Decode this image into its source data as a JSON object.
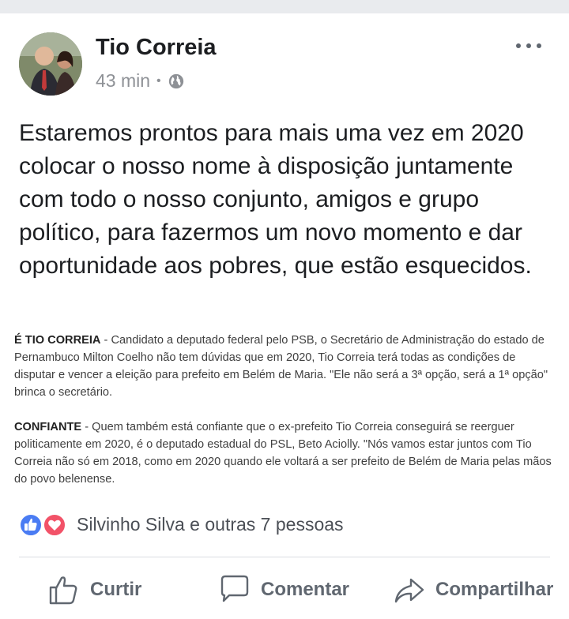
{
  "post": {
    "author": "Tio Correia",
    "time": "43 min",
    "separator": "•",
    "privacy_icon": "globe-icon",
    "menu_icon": "more-options-icon",
    "text": "Estaremos prontos para mais uma vez em 2020 colocar o nosso nome à disposição juntamente com todo o nosso conjunto, amigos e grupo político, para fazermos um novo momento e dar oportunidade aos pobres, que estão esquecidos."
  },
  "clipping": {
    "p1_heading": "É TIO CORREIA",
    "p1_body": " - Candidato a deputado federal pelo PSB, o Secretário de Administração do estado de Pernambuco Milton Coelho não tem dúvidas que em 2020, Tio Correia terá todas as condições de disputar e vencer a eleição para prefeito em Belém de Maria. \"Ele não será a 3ª opção, será a 1ª opção\" brinca o secretário.",
    "p2_heading": "CONFIANTE",
    "p2_body": " - Quem também está confiante que o ex-prefeito Tio Correia conseguirá se reerguer politicamente em 2020, é o deputado estadual do PSL, Beto Aciolly. \"Nós vamos estar juntos com Tio Correia não só em 2018, como em 2020 quando ele voltará a ser prefeito de Belém de Maria pelas mãos do povo belenense."
  },
  "reactions": {
    "icons": [
      "like-reaction-icon",
      "love-reaction-icon"
    ],
    "summary": "Silvinho Silva e outras 7 pessoas"
  },
  "actions": {
    "like_label": "Curtir",
    "comment_label": "Comentar",
    "share_label": "Compartilhar"
  },
  "colors": {
    "like_blue": "#4267b2",
    "love_red": "#f25268",
    "action_gray": "#606770"
  }
}
